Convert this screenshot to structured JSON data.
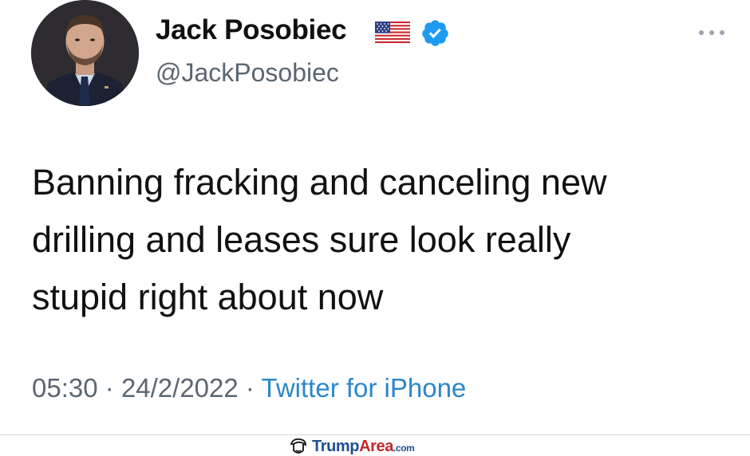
{
  "tweet": {
    "display_name": "Jack Posobiec",
    "handle": "@JackPosobiec",
    "text": "Banning fracking and canceling new\ndrilling and leases sure look really\nstupid right about now",
    "time": "05:30",
    "date": "24/2/2022",
    "separator": "·",
    "source": "Twitter for iPhone",
    "badges": [
      "us-flag-icon",
      "verified-badge-icon"
    ],
    "more_icon": "more-options-icon"
  },
  "watermark": {
    "brand_main": "Trump",
    "brand_accent": "Area",
    "brand_suffix": ".com",
    "icon": "trump-hair-icon"
  },
  "colors": {
    "verified_blue": "#1d9bf0",
    "link_blue": "#2a87c9",
    "secondary_text": "#5b6670",
    "brand_blue": "#1d4f94",
    "brand_red": "#c4262e"
  }
}
